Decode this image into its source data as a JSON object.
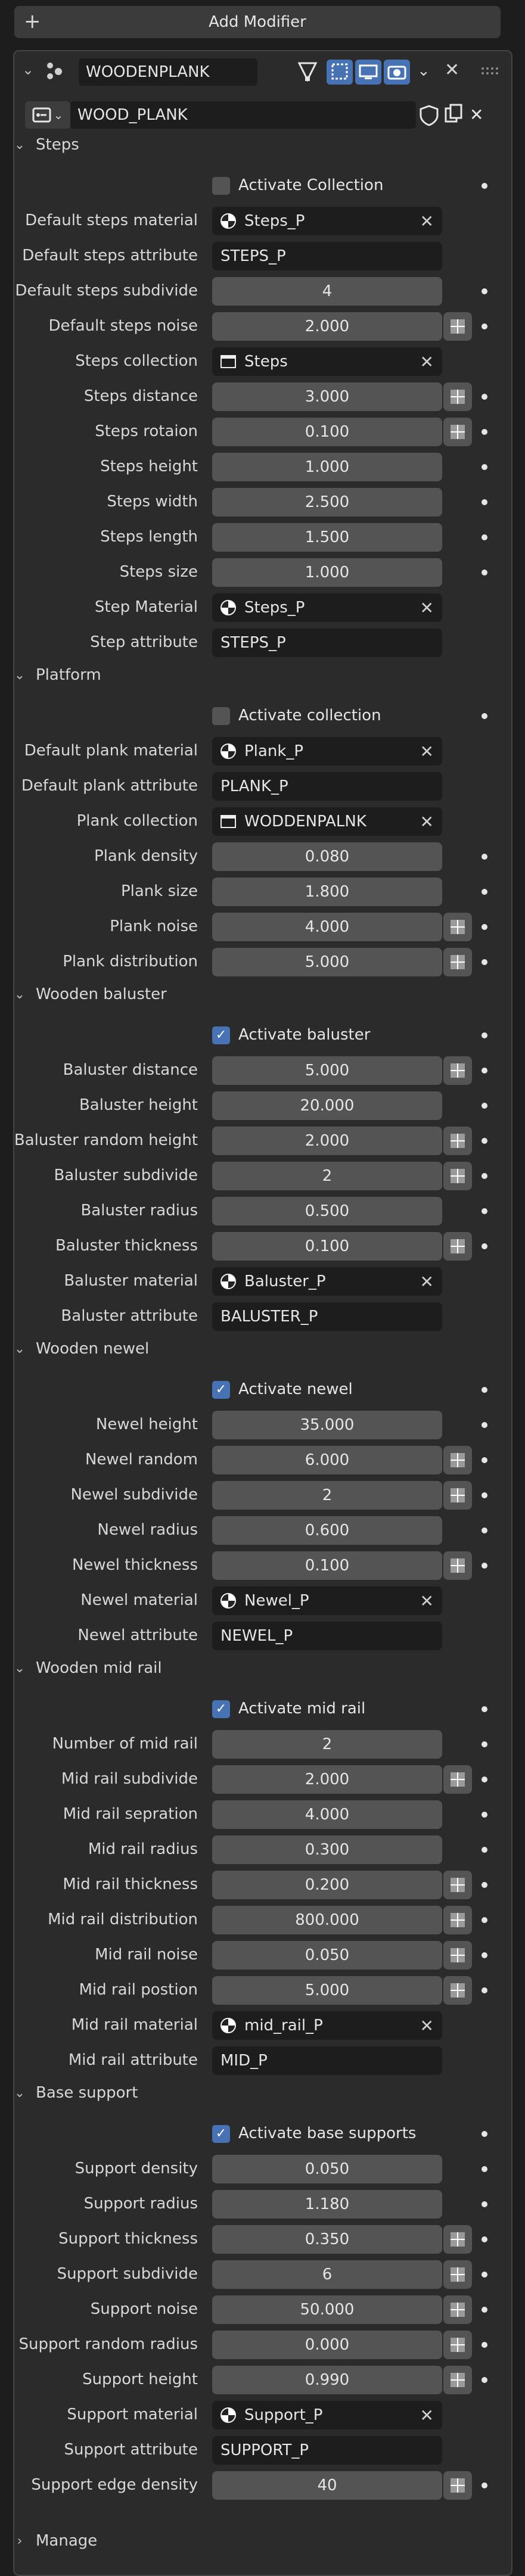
{
  "add_modifier": "Add Modifier",
  "modifier": {
    "name": "WOODENPLANK",
    "node_group": "WOOD_PLANK"
  },
  "sections": [
    {
      "title": "Steps",
      "rows": [
        {
          "type": "check",
          "label": "Activate Collection",
          "checked": false
        },
        {
          "type": "material",
          "label": "Default steps material",
          "value": "Steps_P"
        },
        {
          "type": "text",
          "label": "Default steps attribute",
          "value": "STEPS_P"
        },
        {
          "type": "number",
          "label": "Default steps subdivide",
          "value": "4",
          "dot": true
        },
        {
          "type": "number",
          "label": "Default steps noise",
          "value": "2.000",
          "grid": true,
          "dot": true
        },
        {
          "type": "collection",
          "label": "Steps collection",
          "value": "Steps"
        },
        {
          "type": "number",
          "label": "Steps distance",
          "value": "3.000",
          "grid": true,
          "dot": true
        },
        {
          "type": "number",
          "label": "Steps rotaion",
          "value": "0.100",
          "grid": true,
          "dot": true
        },
        {
          "type": "number",
          "label": "Steps height",
          "value": "1.000",
          "dot": true
        },
        {
          "type": "number",
          "label": "Steps width",
          "value": "2.500",
          "dot": true
        },
        {
          "type": "number",
          "label": "Steps length",
          "value": "1.500",
          "dot": true
        },
        {
          "type": "number",
          "label": "Steps size",
          "value": "1.000",
          "dot": true
        },
        {
          "type": "material",
          "label": "Step Material",
          "value": "Steps_P"
        },
        {
          "type": "text",
          "label": "Step attribute",
          "value": "STEPS_P"
        }
      ]
    },
    {
      "title": "Platform",
      "rows": [
        {
          "type": "check",
          "label": "Activate collection",
          "checked": false
        },
        {
          "type": "material",
          "label": "Default plank material",
          "value": "Plank_P"
        },
        {
          "type": "text",
          "label": "Default plank attribute",
          "value": "PLANK_P"
        },
        {
          "type": "collection",
          "label": "Plank collection",
          "value": "WODDENPALNK"
        },
        {
          "type": "number",
          "label": "Plank density",
          "value": "0.080",
          "dot": true
        },
        {
          "type": "number",
          "label": "Plank size",
          "value": "1.800",
          "dot": true
        },
        {
          "type": "number",
          "label": "Plank noise",
          "value": "4.000",
          "grid": true,
          "dot": true
        },
        {
          "type": "number",
          "label": "Plank distribution",
          "value": "5.000",
          "grid": true,
          "dot": true
        }
      ]
    },
    {
      "title": "Wooden baluster",
      "rows": [
        {
          "type": "check",
          "label": "Activate baluster",
          "checked": true
        },
        {
          "type": "number",
          "label": "Baluster distance",
          "value": "5.000",
          "grid": true,
          "dot": true
        },
        {
          "type": "number",
          "label": "Baluster height",
          "value": "20.000",
          "dot": true
        },
        {
          "type": "number",
          "label": "Baluster random height",
          "value": "2.000",
          "grid": true,
          "dot": true
        },
        {
          "type": "number",
          "label": "Baluster subdivide",
          "value": "2",
          "grid": true,
          "dot": true
        },
        {
          "type": "number",
          "label": "Baluster radius",
          "value": "0.500",
          "dot": true
        },
        {
          "type": "number",
          "label": "Baluster thickness",
          "value": "0.100",
          "grid": true,
          "dot": true
        },
        {
          "type": "material",
          "label": "Baluster material",
          "value": "Baluster_P"
        },
        {
          "type": "text",
          "label": "Baluster attribute",
          "value": "BALUSTER_P"
        }
      ]
    },
    {
      "title": "Wooden newel",
      "rows": [
        {
          "type": "check",
          "label": "Activate newel",
          "checked": true
        },
        {
          "type": "number",
          "label": "Newel height",
          "value": "35.000",
          "dot": true
        },
        {
          "type": "number",
          "label": "Newel random",
          "value": "6.000",
          "grid": true,
          "dot": true
        },
        {
          "type": "number",
          "label": "Newel subdivide",
          "value": "2",
          "grid": true,
          "dot": true
        },
        {
          "type": "number",
          "label": "Newel radius",
          "value": "0.600",
          "dot": true
        },
        {
          "type": "number",
          "label": "Newel thickness",
          "value": "0.100",
          "grid": true,
          "dot": true
        },
        {
          "type": "material",
          "label": "Newel material",
          "value": "Newel_P"
        },
        {
          "type": "text",
          "label": "Newel attribute",
          "value": "NEWEL_P"
        }
      ]
    },
    {
      "title": "Wooden mid rail",
      "rows": [
        {
          "type": "check",
          "label": "Activate mid rail",
          "checked": true
        },
        {
          "type": "number",
          "label": "Number of mid rail",
          "value": "2",
          "dot": true
        },
        {
          "type": "number",
          "label": "Mid rail subdivide",
          "value": "2.000",
          "grid": true,
          "dot": true
        },
        {
          "type": "number",
          "label": "Mid rail sepration",
          "value": "4.000",
          "dot": true
        },
        {
          "type": "number",
          "label": "Mid rail radius",
          "value": "0.300",
          "dot": true
        },
        {
          "type": "number",
          "label": "Mid rail thickness",
          "value": "0.200",
          "grid": true,
          "dot": true
        },
        {
          "type": "number",
          "label": "Mid rail distribution",
          "value": "800.000",
          "grid": true,
          "dot": true
        },
        {
          "type": "number",
          "label": "Mid rail noise",
          "value": "0.050",
          "grid": true,
          "dot": true
        },
        {
          "type": "number",
          "label": "Mid rail postion",
          "value": "5.000",
          "grid": true,
          "dot": true
        },
        {
          "type": "material",
          "label": "Mid rail material",
          "value": "mid_rail_P"
        },
        {
          "type": "text",
          "label": "Mid rail attribute",
          "value": "MID_P"
        }
      ]
    },
    {
      "title": "Base support",
      "rows": [
        {
          "type": "check",
          "label": "Activate base supports",
          "checked": true
        },
        {
          "type": "number",
          "label": "Support density",
          "value": "0.050",
          "dot": true
        },
        {
          "type": "number",
          "label": "Support radius",
          "value": "1.180",
          "dot": true
        },
        {
          "type": "number",
          "label": "Support thickness",
          "value": "0.350",
          "grid": true,
          "dot": true
        },
        {
          "type": "number",
          "label": "Support subdivide",
          "value": "6",
          "grid": true,
          "dot": true
        },
        {
          "type": "number",
          "label": "Support noise",
          "value": "50.000",
          "grid": true,
          "dot": true
        },
        {
          "type": "number",
          "label": "Support  random radius",
          "value": "0.000",
          "grid": true,
          "dot": true
        },
        {
          "type": "number",
          "label": "Support height",
          "value": "0.990",
          "grid": true,
          "dot": true
        },
        {
          "type": "material",
          "label": "Support material",
          "value": "Support_P"
        },
        {
          "type": "text",
          "label": "Support attribute",
          "value": "SUPPORT_P"
        },
        {
          "type": "number",
          "label": "Support edge density",
          "value": "40",
          "grid": true,
          "dot": true
        }
      ]
    }
  ],
  "manage": "Manage",
  "colors": {
    "accent": "#4772b3",
    "field": "#545454",
    "panel": "#2b2b2b",
    "background": "#1d1d1d"
  }
}
